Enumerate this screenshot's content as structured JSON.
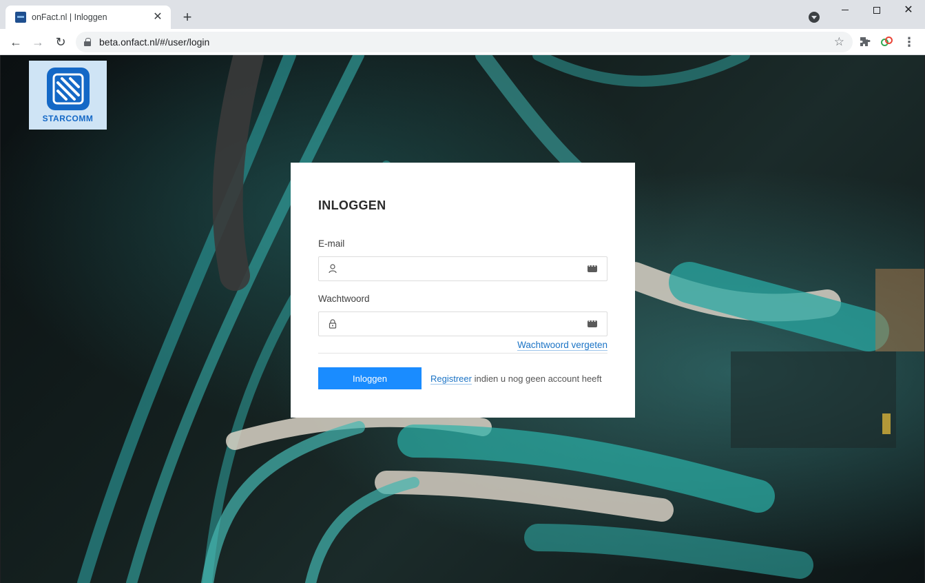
{
  "browser": {
    "tab_title": "onFact.nl | Inloggen",
    "tab_close": "✕",
    "new_tab": "+",
    "url": "beta.onfact.nl/#/user/login"
  },
  "brand": {
    "name": "STARCOMM",
    "color": "#1468c6"
  },
  "login": {
    "title": "INLOGGEN",
    "email_label": "E-mail",
    "email_value": "",
    "password_label": "Wachtwoord",
    "password_value": "",
    "forgot_password": "Wachtwoord vergeten",
    "submit_label": "Inloggen",
    "register_link": "Registreer",
    "register_suffix": " indien u nog geen account heeft",
    "button_color": "#1a8cff"
  }
}
